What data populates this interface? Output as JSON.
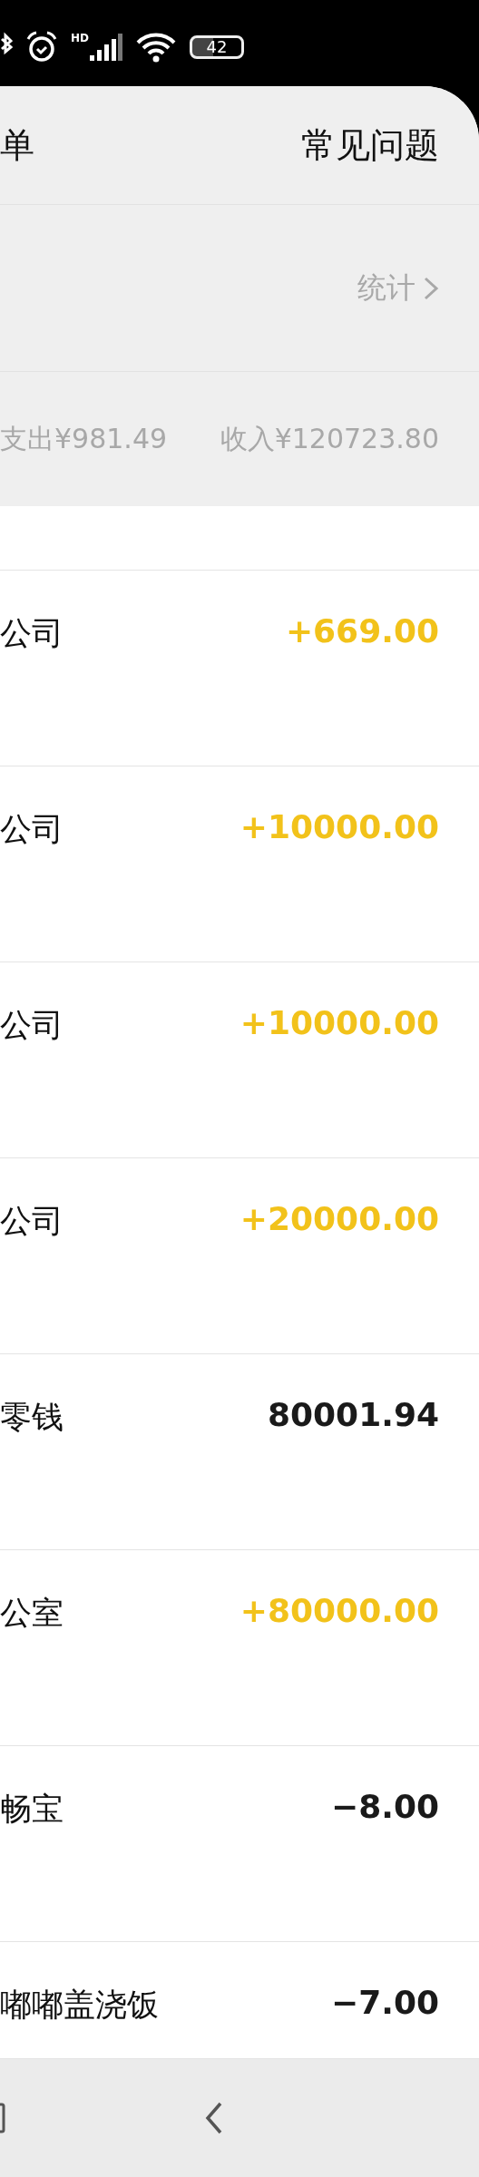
{
  "status_bar": {
    "network_label": "HD",
    "battery": "42"
  },
  "header": {
    "title": "单",
    "help": "常见问题"
  },
  "stats_link": "统计",
  "summary": {
    "expense": "支出¥981.49",
    "income": "收入¥120723.80"
  },
  "transactions": [
    {
      "name": "公司",
      "amount": "+669.00",
      "income": true
    },
    {
      "name": "公司",
      "amount": "+10000.00",
      "income": true
    },
    {
      "name": "公司",
      "amount": "+10000.00",
      "income": true
    },
    {
      "name": "公司",
      "amount": "+20000.00",
      "income": true
    },
    {
      "name": "零钱",
      "amount": "80001.94",
      "income": false
    },
    {
      "name": "公室",
      "amount": "+80000.00",
      "income": true
    },
    {
      "name": "畅宝",
      "amount": "−8.00",
      "income": false
    },
    {
      "name": "嘟嘟盖浇饭",
      "amount": "−7.00",
      "income": false
    }
  ]
}
